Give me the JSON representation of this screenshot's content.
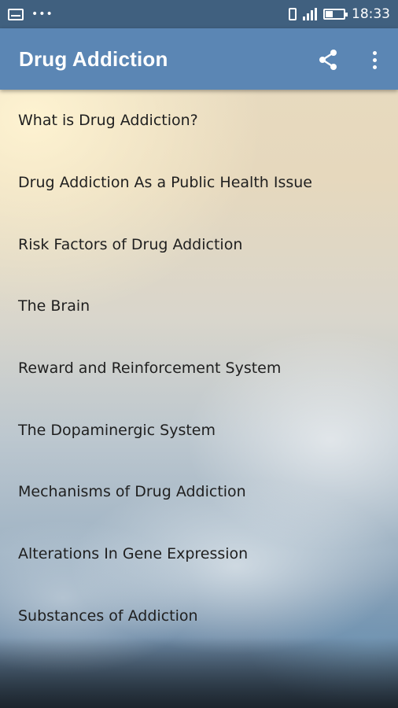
{
  "status_bar": {
    "time": "18:33",
    "icons": [
      "mail-icon",
      "more-dots-icon",
      "vibrate-icon",
      "signal-icon",
      "battery-icon"
    ]
  },
  "app_bar": {
    "title": "Drug Addiction",
    "color": "#5b86b4",
    "actions": [
      "share-icon",
      "overflow-menu-icon"
    ]
  },
  "menu": {
    "items": [
      "What is Drug Addiction?",
      "Drug Addiction As a Public Health Issue",
      "Risk Factors of Drug Addiction",
      "The Brain",
      "Reward and Reinforcement System",
      "The Dopaminergic System",
      "Mechanisms of Drug Addiction",
      "Alterations In Gene Expression",
      "Substances of Addiction"
    ]
  }
}
